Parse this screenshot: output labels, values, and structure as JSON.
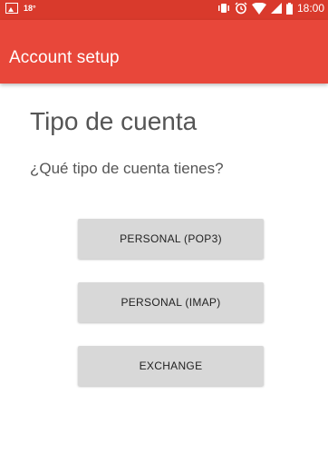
{
  "status_bar": {
    "temperature": "18°",
    "time": "18:00",
    "icons": [
      "image-icon",
      "vibrate-icon",
      "alarm-icon",
      "wifi-icon",
      "signal-icon",
      "battery-icon"
    ]
  },
  "app_bar": {
    "title": "Account setup"
  },
  "main": {
    "heading": "Tipo de cuenta",
    "question": "¿Qué tipo de cuenta tienes?",
    "options": [
      {
        "label": "PERSONAL (POP3)"
      },
      {
        "label": "PERSONAL (IMAP)"
      },
      {
        "label": "EXCHANGE"
      }
    ]
  },
  "colors": {
    "status_bar": "#d93a2c",
    "app_bar": "#e8473a",
    "button_bg": "#d8d8d8",
    "text_gray": "#555555"
  }
}
